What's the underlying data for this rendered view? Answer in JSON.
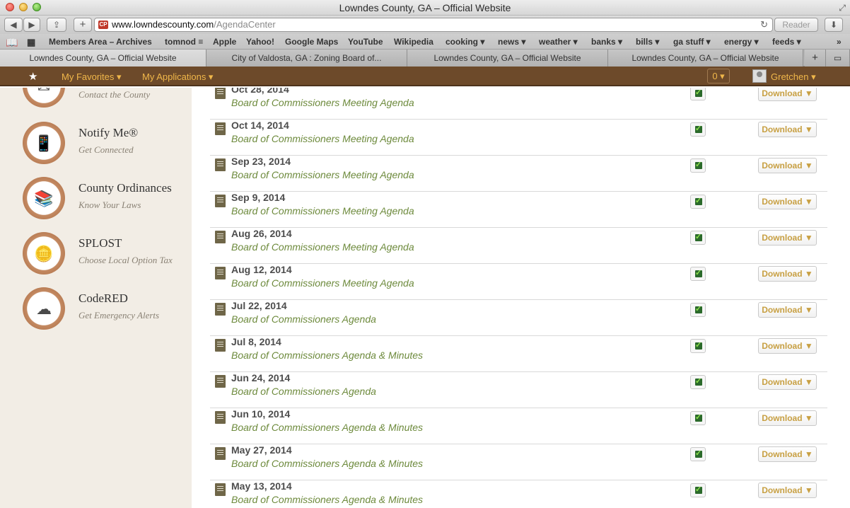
{
  "window": {
    "title": "Lowndes County, GA – Official Website",
    "resize_icon": "⤢"
  },
  "toolbar": {
    "back_icon": "◀",
    "forward_icon": "▶",
    "share_icon": "⇪",
    "new_tab_icon": "+",
    "favicon_text": "CP",
    "url_host": "www.lowndescounty.com",
    "url_path": "/AgendaCenter",
    "reload_icon": "↻",
    "reader_label": "Reader",
    "download_icon": "⬇"
  },
  "bookmarks": [
    {
      "label": "Members Area – Archives"
    },
    {
      "label": "tomnod ≡"
    },
    {
      "label": "Apple"
    },
    {
      "label": "Yahoo!"
    },
    {
      "label": "Google Maps"
    },
    {
      "label": "YouTube"
    },
    {
      "label": "Wikipedia"
    },
    {
      "label": "cooking ▾"
    },
    {
      "label": "news ▾"
    },
    {
      "label": "weather ▾"
    },
    {
      "label": "banks ▾"
    },
    {
      "label": "bills ▾"
    },
    {
      "label": "ga stuff ▾"
    },
    {
      "label": "energy ▾"
    },
    {
      "label": "feeds ▾"
    },
    {
      "label": "»"
    }
  ],
  "tabs": [
    {
      "label": "Lowndes County, GA – Official Website"
    },
    {
      "label": "City of Valdosta, GA : Zoning Board of..."
    },
    {
      "label": "Lowndes County, GA – Official Website"
    },
    {
      "label": "Lowndes County, GA – Official Website"
    }
  ],
  "sitebar": {
    "star_icon": "★",
    "favorites": "My Favorites ▾",
    "applications": "My Applications ▾",
    "count": "0 ▾",
    "user": "Gretchen ▾"
  },
  "sidebar": {
    "items": [
      {
        "title": "",
        "subtitle": "Contact the County",
        "icon": "✉"
      },
      {
        "title": "Notify Me®",
        "subtitle": "Get Connected",
        "icon": "📱"
      },
      {
        "title": "County Ordinances",
        "subtitle": "Know Your Laws",
        "icon": "📚"
      },
      {
        "title": "SPLOST",
        "subtitle": "Choose Local Option Tax",
        "icon": "🪙"
      },
      {
        "title": "CodeRED",
        "subtitle": "Get Emergency Alerts",
        "icon": "☁"
      }
    ]
  },
  "agendas": {
    "download_label": "Download ▼",
    "rows": [
      {
        "date": "Oct 28, 2014",
        "title": "Board of Commissioners Meeting Agenda"
      },
      {
        "date": "Oct 14, 2014",
        "title": "Board of Commissioners Meeting Agenda"
      },
      {
        "date": "Sep 23, 2014",
        "title": "Board of Commissioners Meeting Agenda"
      },
      {
        "date": "Sep 9, 2014",
        "title": "Board of Commissioners Meeting Agenda"
      },
      {
        "date": "Aug 26, 2014",
        "title": "Board of Commissioners Meeting Agenda"
      },
      {
        "date": "Aug 12, 2014",
        "title": "Board of Commissioners Meeting Agenda"
      },
      {
        "date": "Jul 22, 2014",
        "title": "Board of Commissioners Agenda"
      },
      {
        "date": "Jul 8, 2014",
        "title": "Board of Commissioners Agenda & Minutes"
      },
      {
        "date": "Jun 24, 2014",
        "title": "Board of Commissioners Agenda"
      },
      {
        "date": "Jun 10, 2014",
        "title": "Board of Commissioners Agenda & Minutes"
      },
      {
        "date": "May 27, 2014",
        "title": "Board of Commissioners Agenda & Minutes"
      },
      {
        "date": "May 13, 2014",
        "title": "Board of Commissioners Agenda & Minutes"
      }
    ]
  }
}
